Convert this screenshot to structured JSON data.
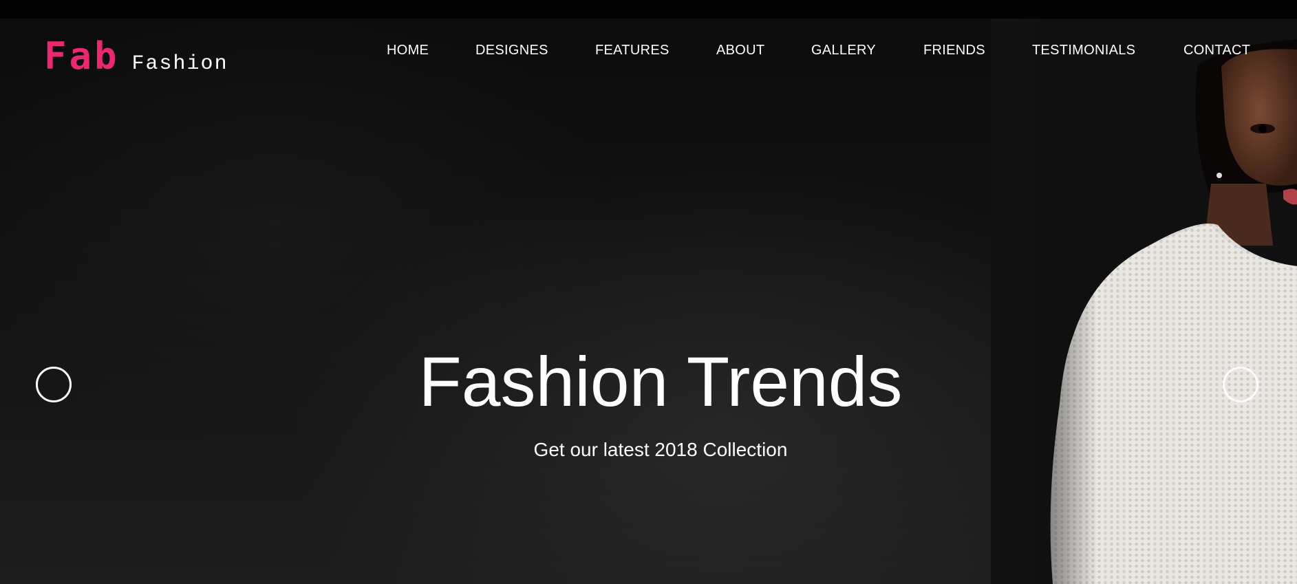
{
  "logo": {
    "primary": "Fab",
    "secondary": "Fashion",
    "accent_color": "#e8296f"
  },
  "nav": {
    "items": [
      {
        "label": "HOME"
      },
      {
        "label": "DESIGNES"
      },
      {
        "label": "FEATURES"
      },
      {
        "label": "ABOUT"
      },
      {
        "label": "GALLERY"
      },
      {
        "label": "FRIENDS"
      },
      {
        "label": "TESTIMONIALS"
      },
      {
        "label": "CONTACT"
      }
    ]
  },
  "hero": {
    "title": "Fashion Trends",
    "subtitle": "Get our latest 2018 Collection",
    "background_color": "#0e0e0e",
    "text_color": "#ffffff"
  },
  "slider": {
    "prev_icon": "circle-outline-icon",
    "next_icon": "circle-outline-icon"
  }
}
